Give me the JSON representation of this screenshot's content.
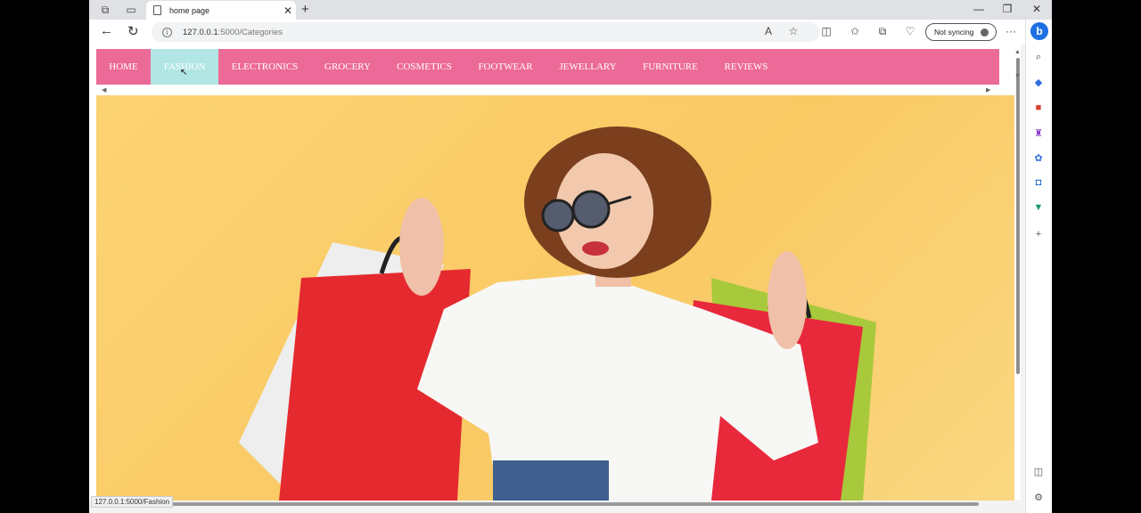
{
  "tab": {
    "title": "home page"
  },
  "window_controls": {
    "minimize": "—",
    "restore": "❐",
    "close": "✕"
  },
  "toolbar": {
    "url_host": "127.0.0.1",
    "url_path": ":5000/Categories",
    "sync_label": "Not syncing"
  },
  "nav": {
    "items": [
      {
        "label": "HOME",
        "width": 61
      },
      {
        "label": "FASHION",
        "width": 76,
        "active": true
      },
      {
        "label": "ELECTRONICS",
        "width": 104
      },
      {
        "label": "GROCERY",
        "width": 82
      },
      {
        "label": "COSMETICS",
        "width": 90
      },
      {
        "label": "FOOTWEAR",
        "width": 92
      },
      {
        "label": "JEWELLARY",
        "width": 93
      },
      {
        "label": "FURNITURE",
        "width": 92
      },
      {
        "label": "REVIEWS",
        "width": 78
      }
    ],
    "bg_color": "#ec6a97",
    "active_color": "#b2e6e4"
  },
  "status_bar": {
    "hover_url": "127.0.0.1:5000/Fashion"
  },
  "hero": {
    "description": "Woman in sunglasses holding shopping bags on yellow background"
  }
}
